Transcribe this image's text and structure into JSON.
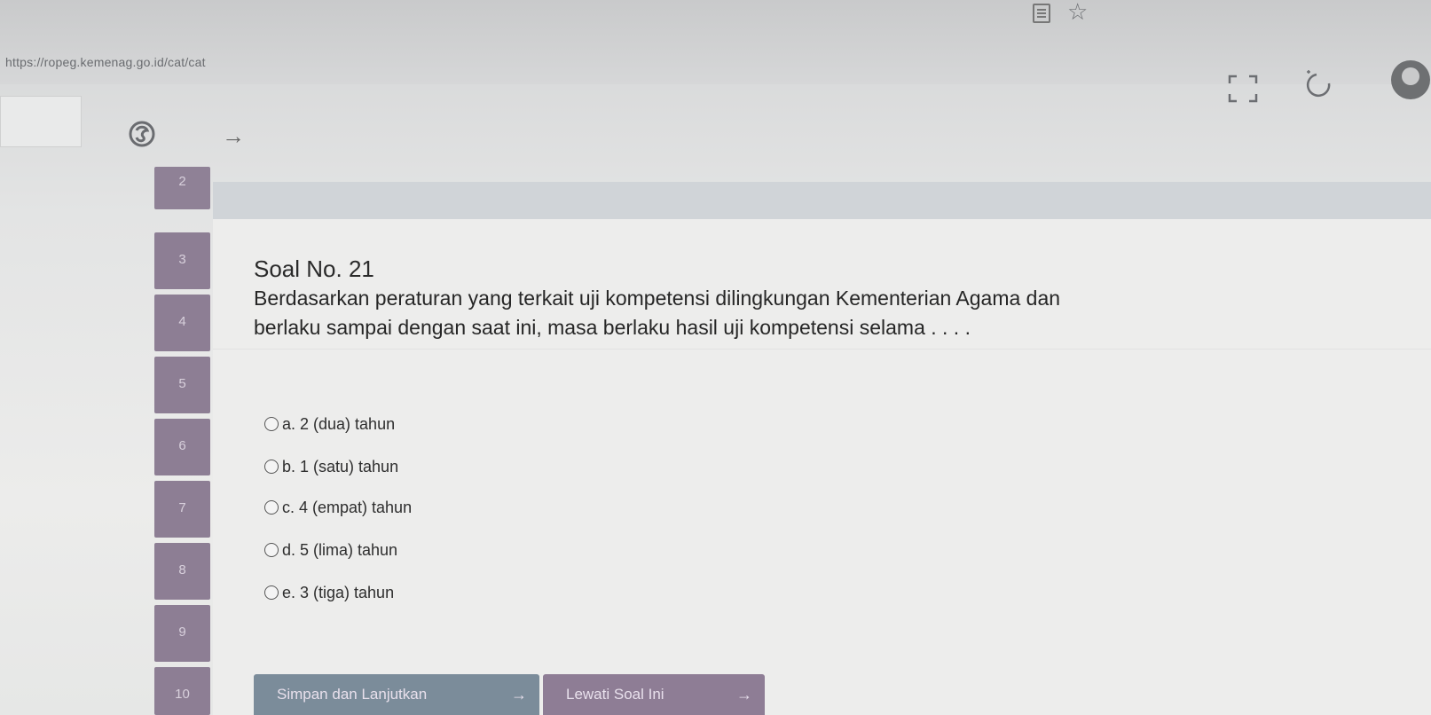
{
  "browser": {
    "url": "https://ropeg.kemenag.go.id/cat/cat",
    "icons": [
      "reader-mode-icon",
      "bookmark-star-icon",
      "fullscreen-icon",
      "timer-icon",
      "user-avatar-icon",
      "app-logo-icon",
      "forward-arrow-icon"
    ]
  },
  "navigation": {
    "numbers": [
      "2",
      "3",
      "4",
      "5",
      "6",
      "7",
      "8",
      "9",
      "10"
    ]
  },
  "question": {
    "title": "Soal No. 21",
    "text_line1": "Berdasarkan peraturan yang terkait uji kompetensi dilingkungan Kementerian Agama dan",
    "text_line2": "berlaku sampai dengan saat ini, masa berlaku hasil uji kompetensi selama . . . .",
    "options": [
      "a. 2 (dua) tahun",
      "b. 1 (satu) tahun",
      "c. 4 (empat) tahun",
      "d. 5 (lima) tahun",
      "e. 3 (tiga) tahun"
    ]
  },
  "actions": {
    "save_next": "Simpan dan Lanjutkan",
    "skip": "Lewati Soal Ini",
    "arrow": "→"
  },
  "colors": {
    "nav_button": "#8d7e94",
    "save_button": "#7b8c9a",
    "skip_button": "#8e7d95"
  }
}
